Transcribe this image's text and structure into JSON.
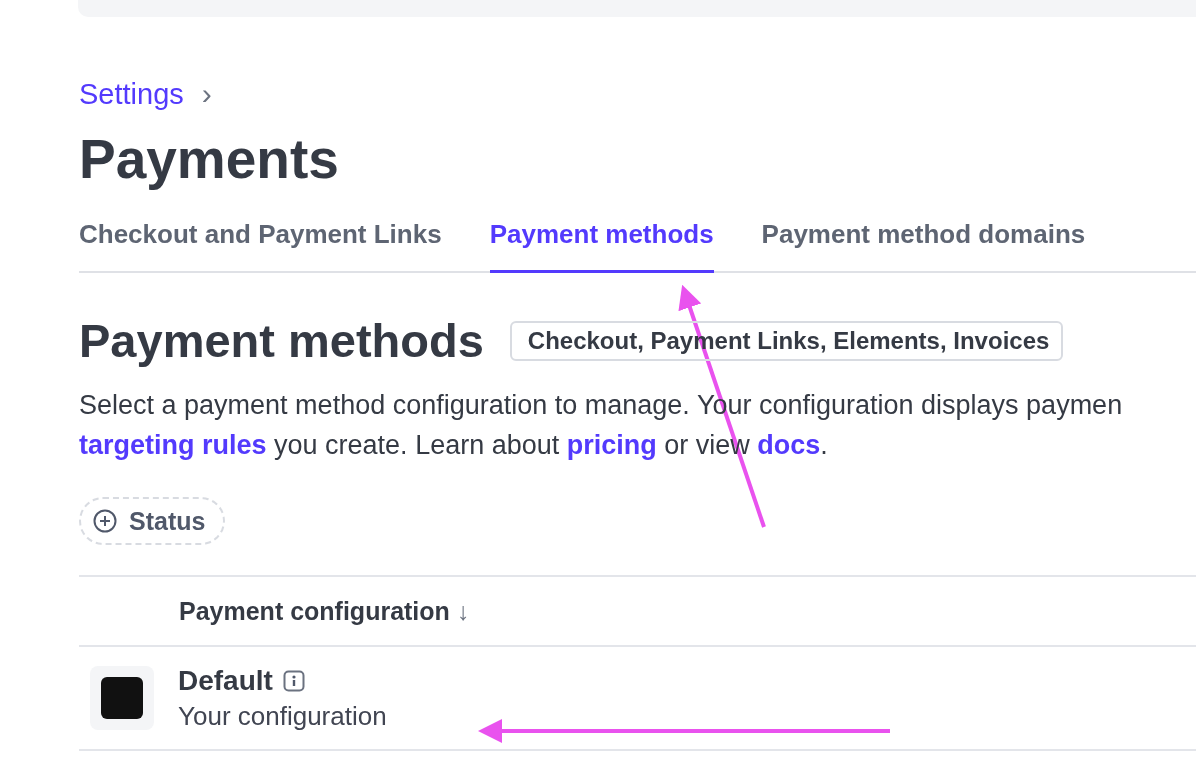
{
  "breadcrumb": {
    "label": "Settings",
    "chevron": "›"
  },
  "title": "Payments",
  "tabs": [
    {
      "label": "Checkout and Payment Links",
      "selected": false
    },
    {
      "label": "Payment methods",
      "selected": true
    },
    {
      "label": "Payment method domains",
      "selected": false
    }
  ],
  "section": {
    "heading": "Payment methods",
    "badge": "Checkout, Payment Links, Elements, Invoices"
  },
  "description": {
    "line_1": "Select a payment method configuration to manage. Your configuration displays paymen",
    "line_2": [
      {
        "kind": "link",
        "text": "targeting rules"
      },
      {
        "kind": "text",
        "text": " you create. Learn about "
      },
      {
        "kind": "link",
        "text": "pricing"
      },
      {
        "kind": "text",
        "text": " or view "
      },
      {
        "kind": "link",
        "text": "docs"
      },
      {
        "kind": "text",
        "text": "."
      }
    ]
  },
  "filter": {
    "label": "Status"
  },
  "table": {
    "columns": [
      {
        "label": "Payment configuration",
        "sort": "↓"
      }
    ],
    "rows": [
      {
        "name": "Default",
        "subtitle": "Your configuration"
      }
    ]
  }
}
